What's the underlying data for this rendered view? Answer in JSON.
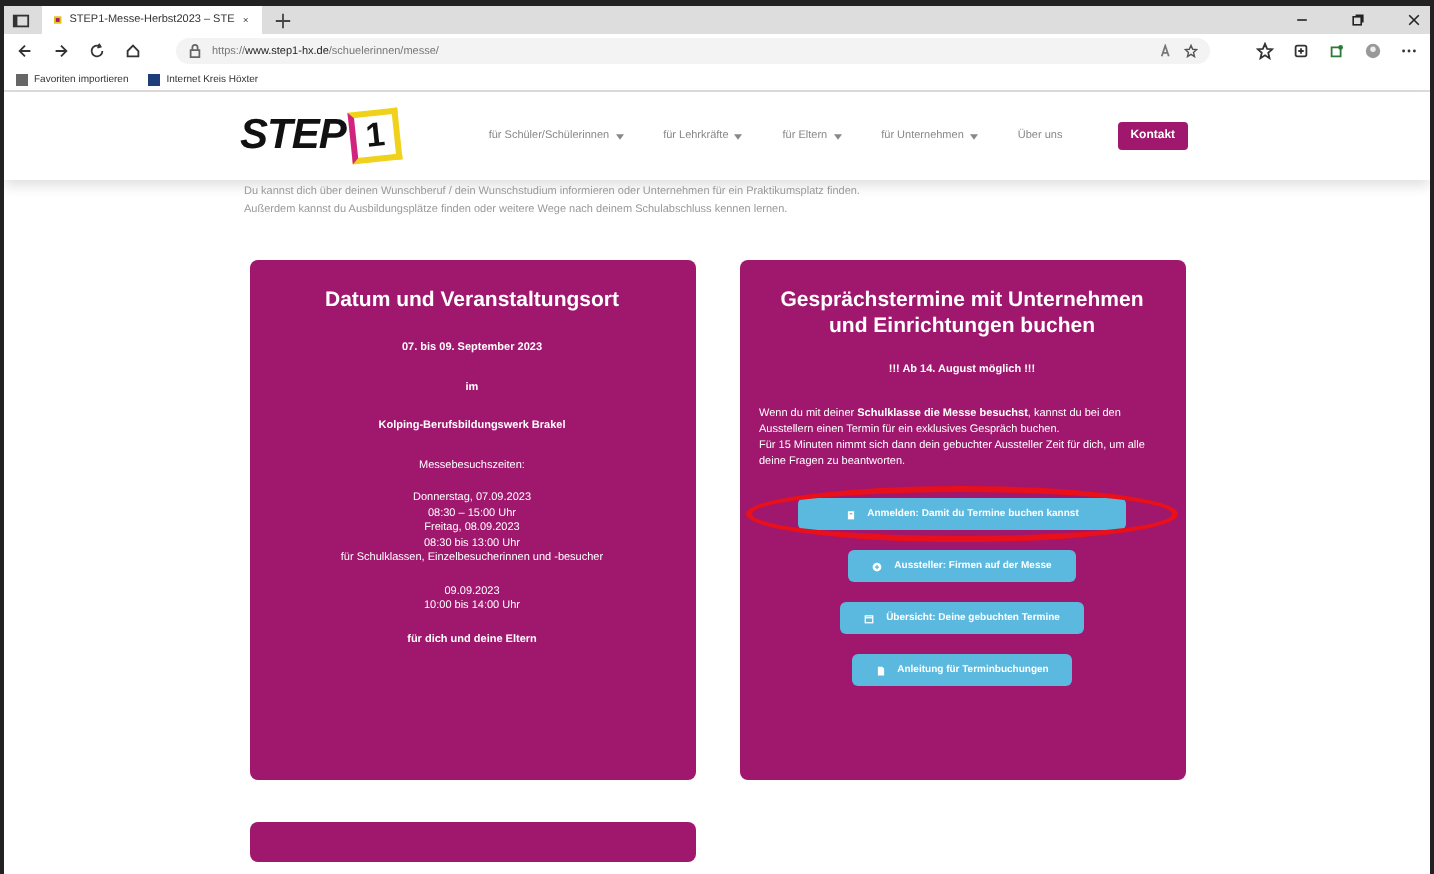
{
  "browser": {
    "tab_title": "STEP1-Messe-Herbst2023 – STE",
    "url_prefix": "https://",
    "url_host": "www.step1-hx.de",
    "url_path": "/schuelerinnen/messe/",
    "favorites": [
      "Favoriten importieren",
      "Internet Kreis Höxter"
    ]
  },
  "header": {
    "logo": {
      "word": "STEP",
      "number": "1"
    },
    "nav": [
      {
        "label": "für Schüler/Schülerinnen",
        "dropdown": true
      },
      {
        "label": "für Lehrkräfte",
        "dropdown": true
      },
      {
        "label": "für Eltern",
        "dropdown": true
      },
      {
        "label": "für Unternehmen",
        "dropdown": true
      },
      {
        "label": "Über uns",
        "dropdown": false
      }
    ],
    "contact_button": "Kontakt"
  },
  "intro": [
    "Du kannst dich über deinen Wunschberuf / dein Wunschstudium informieren oder Unternehmen für ein Praktikumsplatz finden.",
    "Außerdem kannst du Ausbildungsplätze finden oder weitere Wege nach deinem Schulabschluss kennen lernen."
  ],
  "event_card": {
    "title": "Datum und Veranstaltungsort",
    "blocks": [
      {
        "bold": true,
        "lines": [
          "07. bis 09. September 2023"
        ]
      },
      {
        "bold": true,
        "lines": [
          "im"
        ]
      },
      {
        "bold": true,
        "lines": [
          "Kolping-Berufsbildungswerk Brakel"
        ]
      },
      {
        "bold": false,
        "lines": [
          "Messebesuchszeiten:"
        ]
      },
      {
        "bold": false,
        "lines": [
          "Donnerstag, 07.09.2023",
          "08:30 – 15:00 Uhr",
          "Freitag, 08.09.2023",
          "08:30 bis 13:00 Uhr",
          "für Schulklassen, Einzelbesucherinnen und -besucher"
        ]
      },
      {
        "bold": false,
        "lines": [
          "09.09.2023",
          "10:00 bis 14:00 Uhr"
        ]
      },
      {
        "bold": true,
        "lines": [
          "für dich und deine Eltern"
        ]
      }
    ]
  },
  "booking_card": {
    "title": "Gesprächstermine mit Unternehmen und Einrichtungen buchen",
    "notice": "!!! Ab 14. August möglich !!!",
    "paragraphs": [
      "Wenn du mit deiner **Schulklasse die Messe besuchst**, kannst du bei den Ausstellern einen Termin für ein exklusives Gespräch buchen.",
      "Für 15 Minuten nimmt sich dann dein gebuchter Aussteller Zeit für dich, um alle deine Fragen zu beantworten."
    ],
    "buttons": [
      {
        "label": "Anmelden: Damit du Termine buchen kannst",
        "kind": "building",
        "highlighted": true
      },
      {
        "label": "Aussteller: Firmen auf der Messe",
        "kind": "plus-circle",
        "highlighted": false
      },
      {
        "label": "Übersicht: Deine gebuchten Termine",
        "kind": "calendar",
        "highlighted": false
      },
      {
        "label": "Anleitung für Terminbuchungen",
        "kind": "document",
        "highlighted": false
      }
    ]
  }
}
